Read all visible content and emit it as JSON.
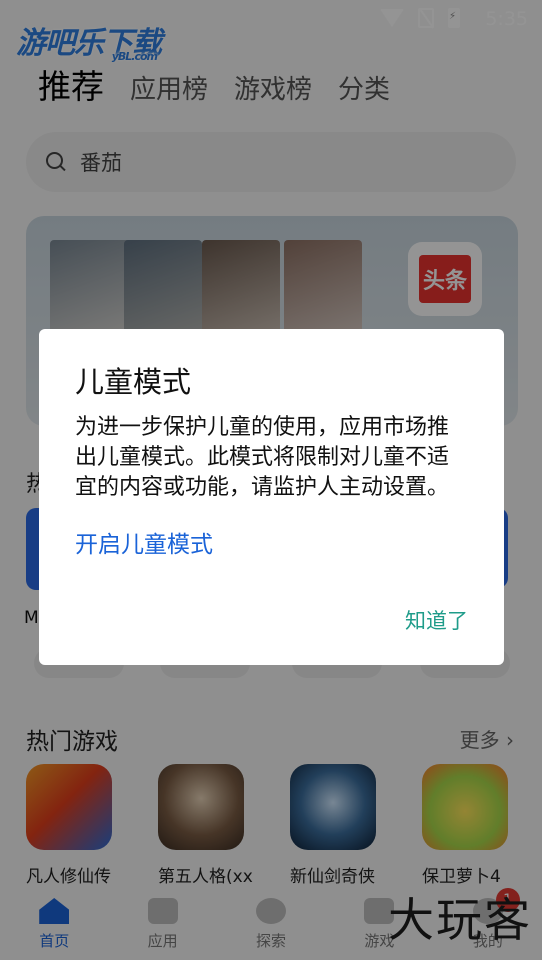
{
  "status": {
    "time": "5:35"
  },
  "watermark": {
    "brand": "游吧乐下载",
    "domain": "yBL.com"
  },
  "tabs": [
    "推荐",
    "应用榜",
    "游戏榜",
    "分类"
  ],
  "search": {
    "placeholder": "番茄"
  },
  "banner": {
    "app_icon_text": "头条"
  },
  "hot_apps": {
    "title": "热",
    "first_app_letter": "M"
  },
  "hot_games": {
    "title": "热门游戏",
    "more": "更多",
    "games": [
      {
        "name": "凡人修仙传"
      },
      {
        "name": "第五人格(xx"
      },
      {
        "name": "新仙剑奇侠"
      },
      {
        "name": "保卫萝卜4"
      }
    ]
  },
  "bottom_nav": {
    "items": [
      "首页",
      "应用",
      "探索",
      "游戏",
      "我的"
    ],
    "badge": "1"
  },
  "dialog": {
    "title": "儿童模式",
    "body": "为进一步保护儿童的使用，应用市场推出儿童模式。此模式将限制对儿童不适宜的内容或功能，请监护人主动设置。",
    "enable_link": "开启儿童模式",
    "ok_button": "知道了"
  },
  "corner_watermark": "大玩客"
}
